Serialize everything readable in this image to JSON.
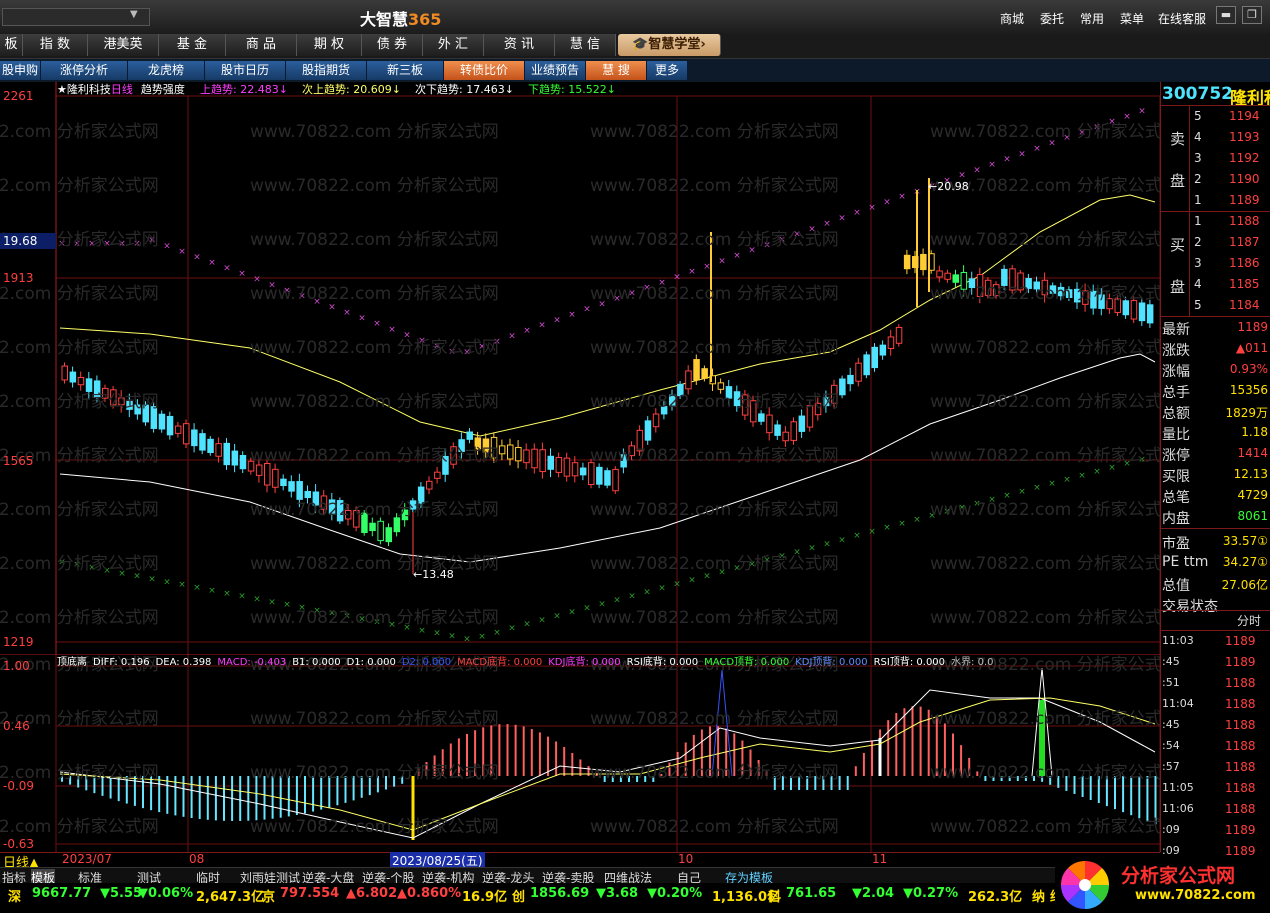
{
  "title_bar": {
    "app_name": "大智慧",
    "app_version": "365",
    "menu": [
      "商城",
      "委托",
      "常用",
      "菜单",
      "在线客服"
    ]
  },
  "nav_primary": [
    {
      "label": "板"
    },
    {
      "label": "指 数"
    },
    {
      "label": "港美英"
    },
    {
      "label": "基 金"
    },
    {
      "label": "商 品"
    },
    {
      "label": "期 权"
    },
    {
      "label": "债 券"
    },
    {
      "label": "外 汇"
    },
    {
      "label": "资 讯"
    },
    {
      "label": "慧 信"
    },
    {
      "label": "智慧学堂"
    }
  ],
  "nav_secondary": [
    {
      "label": "股申购"
    },
    {
      "label": "涨停分析"
    },
    {
      "label": "龙虎榜"
    },
    {
      "label": "股市日历"
    },
    {
      "label": "股指期货"
    },
    {
      "label": "新三板"
    },
    {
      "label": "转债比价"
    },
    {
      "label": "业绩预告"
    },
    {
      "label": "慧 搜"
    },
    {
      "label": "更多"
    }
  ],
  "main_chart": {
    "stock": "隆利科技",
    "period": "日线",
    "indicator": "趋势强度",
    "legend": [
      {
        "name": "上趋势",
        "value": "22.483",
        "color": "#ff3cff"
      },
      {
        "name": "次上趋势",
        "value": "20.609",
        "color": "#ffff66"
      },
      {
        "name": "次下趋势",
        "value": "17.463",
        "color": "#ffffff"
      },
      {
        "name": "下趋势",
        "value": "15.522",
        "color": "#33ff33"
      }
    ],
    "y_labels": [
      "2261",
      "1913",
      "1565",
      "1219"
    ],
    "current_price_tag": "19.68",
    "high_annotation": "20.98",
    "low_annotation": "13.48"
  },
  "sub_chart": {
    "indicator": "顶底离",
    "legend": [
      {
        "text": "DIFF: 0.196",
        "color": "#ffffff"
      },
      {
        "text": "DEA: 0.398",
        "color": "#ffffff"
      },
      {
        "text": "MACD: -0.403",
        "color": "#ff3cff"
      },
      {
        "text": "B1: 0.000",
        "color": "#ffffff"
      },
      {
        "text": "D1: 0.000",
        "color": "#ffffff"
      },
      {
        "text": "D2: 0.000",
        "color": "#3355ff"
      },
      {
        "text": "MACD底背: 0.000",
        "color": "#ff4040"
      },
      {
        "text": "KDJ底背: 0.000",
        "color": "#ff3cff"
      },
      {
        "text": "RSI底背: 0.000",
        "color": "#ffffff"
      },
      {
        "text": "MACD顶背: 0.000",
        "color": "#33ff33"
      },
      {
        "text": "KDJ顶背: 0.000",
        "color": "#5f8cff"
      },
      {
        "text": "RSI顶背: 0.000",
        "color": "#ffffff"
      },
      {
        "text": "水界: 0.0",
        "color": "#bbbbbb"
      }
    ],
    "y_labels": [
      "1.00",
      "0.46",
      "-0.09",
      "-0.63"
    ]
  },
  "chart_data": {
    "type": "candlestick",
    "x_labels": [
      "2023/07",
      "08",
      "2023/08/25(五)",
      "10",
      "11"
    ],
    "ylim": [
      12.19,
      22.61
    ],
    "extremes": {
      "high": 20.98,
      "low": 13.48
    }
  },
  "right_panel": {
    "code": "300752",
    "name": "隆利科技",
    "sell_label": [
      "卖",
      "盘"
    ],
    "buy_label": [
      "买",
      "盘"
    ],
    "asks": [
      {
        "level": "5",
        "price": "1194"
      },
      {
        "level": "4",
        "price": "1193"
      },
      {
        "level": "3",
        "price": "1192"
      },
      {
        "level": "2",
        "price": "1190"
      },
      {
        "level": "1",
        "price": "1189"
      }
    ],
    "bids": [
      {
        "level": "1",
        "price": "1188"
      },
      {
        "level": "2",
        "price": "1187"
      },
      {
        "level": "3",
        "price": "1186"
      },
      {
        "level": "4",
        "price": "1185"
      },
      {
        "level": "5",
        "price": "1184"
      }
    ],
    "stats": [
      {
        "label": "最新",
        "value": "1189",
        "color": "#ff4040"
      },
      {
        "label": "涨跌",
        "value": "▲011",
        "color": "#ff4040"
      },
      {
        "label": "涨幅",
        "value": "0.93%",
        "color": "#ff4040"
      },
      {
        "label": "总手",
        "value": "15356",
        "color": "#ffe100"
      },
      {
        "label": "总额",
        "value": "1829万",
        "color": "#ffe100"
      },
      {
        "label": "量比",
        "value": "1.18",
        "color": "#ffe100"
      },
      {
        "label": "涨停",
        "value": "1414",
        "color": "#ff4040"
      },
      {
        "label": "买限",
        "value": "12.13",
        "color": "#ffe100"
      },
      {
        "label": "总笔",
        "value": "4729",
        "color": "#ffe100"
      },
      {
        "label": "内盘",
        "value": "8061",
        "color": "#33ff33"
      },
      {
        "label": "市盈",
        "value": "33.57①",
        "color": "#ffe100"
      },
      {
        "label": "PE ttm",
        "value": "34.27①",
        "color": "#ffe100"
      },
      {
        "label": "总值",
        "value": "27.06亿",
        "color": "#ffe100"
      },
      {
        "label": "交易状态",
        "value": "",
        "color": "#ffe100"
      }
    ],
    "tick_header": "分时",
    "ticks": [
      {
        "time": "11:03",
        "price": "1189"
      },
      {
        "time": ":45",
        "price": "1189"
      },
      {
        "time": ":51",
        "price": "1188"
      },
      {
        "time": "11:04",
        "price": "1188"
      },
      {
        "time": ":45",
        "price": "1188"
      },
      {
        "time": ":54",
        "price": "1188"
      },
      {
        "time": ":57",
        "price": "1188"
      },
      {
        "time": "11:05",
        "price": "1188"
      },
      {
        "time": "11:06",
        "price": "1188"
      },
      {
        "time": ":09",
        "price": "1189"
      },
      {
        "time": ":09",
        "price": "1189"
      }
    ]
  },
  "bottom_tabs": [
    "指标",
    "模板",
    "标准",
    "测试",
    "临时",
    "刘雨娃测试",
    "逆袭-大盘",
    "逆袭-个股",
    "逆袭-机构",
    "逆袭-龙头",
    "逆袭-卖股",
    "四维战法",
    "自己",
    "存为模板"
  ],
  "period_label": "日线",
  "ticker": [
    {
      "code": "深",
      "value": "9667.77",
      "change": "▼5.55",
      "pct": "▼0.06%",
      "amount": "2,647.3亿",
      "color": "#33ff33"
    },
    {
      "code": "京",
      "value": "797.554",
      "change": "▲6.802",
      "pct": "▲0.860%",
      "amount": "16.9亿",
      "color": "#ff4040"
    },
    {
      "code": "创",
      "value": "1856.69",
      "change": "▼3.68",
      "pct": "▼0.20%",
      "amount": "1,136.0亿",
      "color": "#33ff33"
    },
    {
      "code": "科",
      "value": "761.65",
      "change": "▼2.04",
      "pct": "▼0.27%",
      "amount": "262.3亿",
      "color": "#33ff33"
    },
    {
      "code": "纳",
      "value": "纳斯",
      "change": "",
      "pct": "",
      "amount": "",
      "color": "#ffe100"
    }
  ],
  "branding": {
    "logo_text": "分析家公式网",
    "url": "www.70822.com"
  },
  "watermark": "www.70822.com 分析家公式网",
  "colors": {
    "up": "#ff4040",
    "down": "#4fe3ff",
    "grid": "#6b0f0f",
    "limit_up": "#ffcc33",
    "limit_down": "#33ff66"
  }
}
